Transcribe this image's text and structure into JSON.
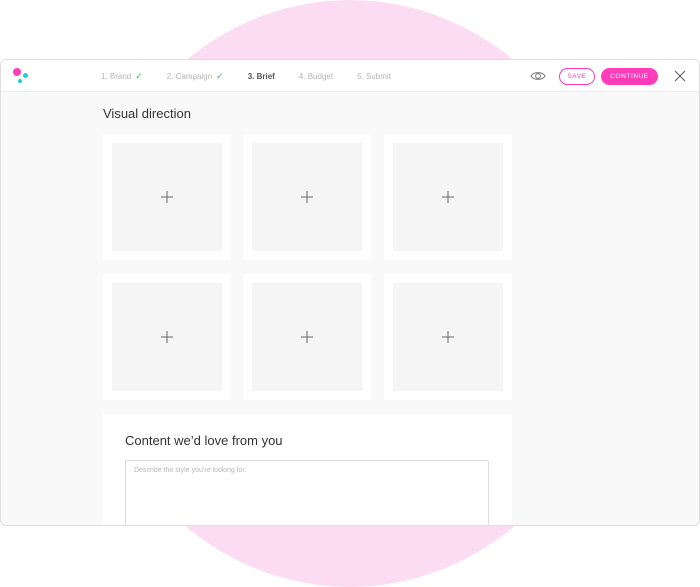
{
  "steps": [
    {
      "label": "1. Brand",
      "done": true
    },
    {
      "label": "2. Campaign",
      "done": true
    },
    {
      "label": "3. Brief",
      "done": false,
      "active": true
    },
    {
      "label": "4. Budget",
      "done": false
    },
    {
      "label": "5. Submit",
      "done": false
    }
  ],
  "toolbar": {
    "save_label": "SAVE",
    "continue_label": "CONTINUE"
  },
  "visual_direction": {
    "title": "Visual direction",
    "tile_count": 6
  },
  "content": {
    "title": "Content we’d love from you",
    "placeholder": "Describe the style you’re looking for."
  },
  "colors": {
    "accent": "#ff3dbb",
    "accent_secondary": "#15d0e6",
    "check": "#39c46b",
    "background_blob": "#fcdcf3"
  }
}
